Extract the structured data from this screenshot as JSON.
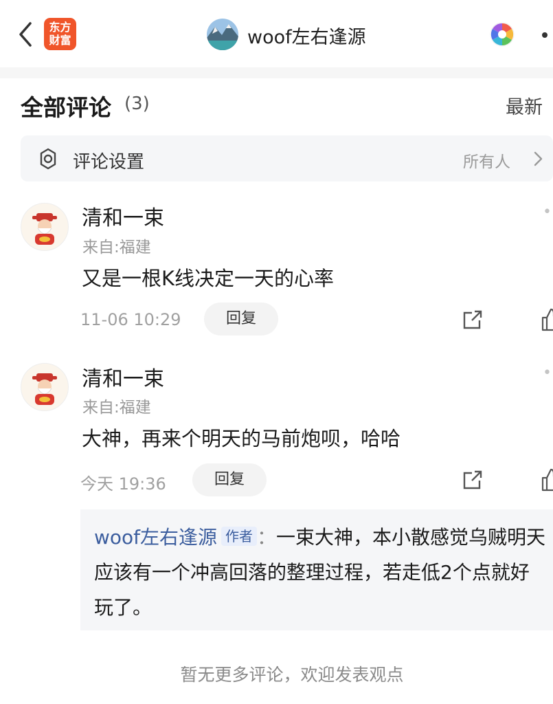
{
  "header": {
    "app_logo_line1": "东方",
    "app_logo_line2": "财富",
    "author_name": "woof左右逢源",
    "brand_color": "#f0552a"
  },
  "comments_section": {
    "title": "全部评论",
    "count": "(3)",
    "sort_label": "最新"
  },
  "settings": {
    "label": "评论设置",
    "value": "所有人",
    "icon": "gear-icon"
  },
  "comments": [
    {
      "username": "清和一束",
      "location": "来自:福建",
      "text": "又是一根K线决定一天的心率",
      "time": "11-06 10:29",
      "reply_label": "回复"
    },
    {
      "username": "清和一束",
      "location": "来自:福建",
      "text": "大神，再来个明天的马前炮呗，哈哈",
      "time": "今天 19:36",
      "reply_label": "回复"
    }
  ],
  "author_reply": {
    "author": "woof左右逢源",
    "badge": "作者",
    "colon": "：",
    "text": "一束大神，本小散感觉乌贼明天应该有一个冲高回落的整理过程，若走低2个点就好玩了。"
  },
  "footer": {
    "note": "暂无更多评论，欢迎发表观点"
  }
}
